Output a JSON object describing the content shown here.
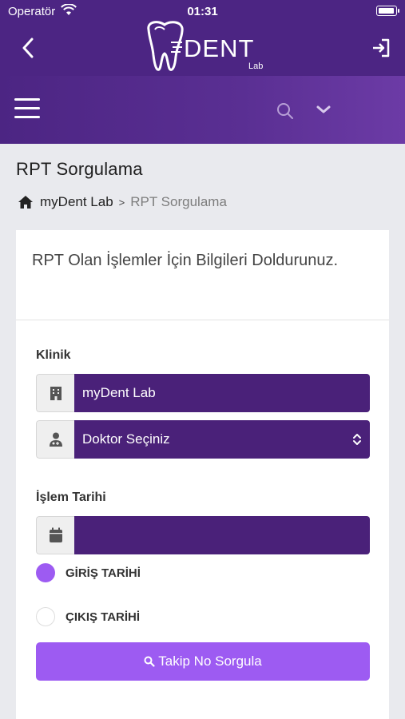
{
  "status_bar": {
    "carrier": "Operatör",
    "time": "01:31"
  },
  "header": {
    "logo_text": "DENT",
    "logo_sub": "Lab"
  },
  "page": {
    "title": "RPT Sorgulama"
  },
  "breadcrumb": {
    "home": "myDent Lab",
    "current": "RPT Sorgulama"
  },
  "form": {
    "intro": "RPT Olan İşlemler İçin Bilgileri Doldurunuz.",
    "clinic_label": "Klinik",
    "clinic_value": "myDent Lab",
    "doctor_value": "Doktor Seçiniz",
    "date_label": "İşlem Tarihi",
    "date_value": "",
    "radio_entry": "GİRİŞ TARİHİ",
    "radio_exit": "ÇIKIŞ TARİHİ",
    "submit_label": "Takip No Sorgula"
  },
  "colors": {
    "header": "#4c2583",
    "field": "#4a2179",
    "accent": "#9d5bf2"
  },
  "icons": [
    "back-icon",
    "logout-icon",
    "menu-icon",
    "search-icon",
    "chevron-down-icon",
    "home-icon",
    "hospital-icon",
    "doctor-icon",
    "calendar-icon",
    "updown-icon"
  ]
}
